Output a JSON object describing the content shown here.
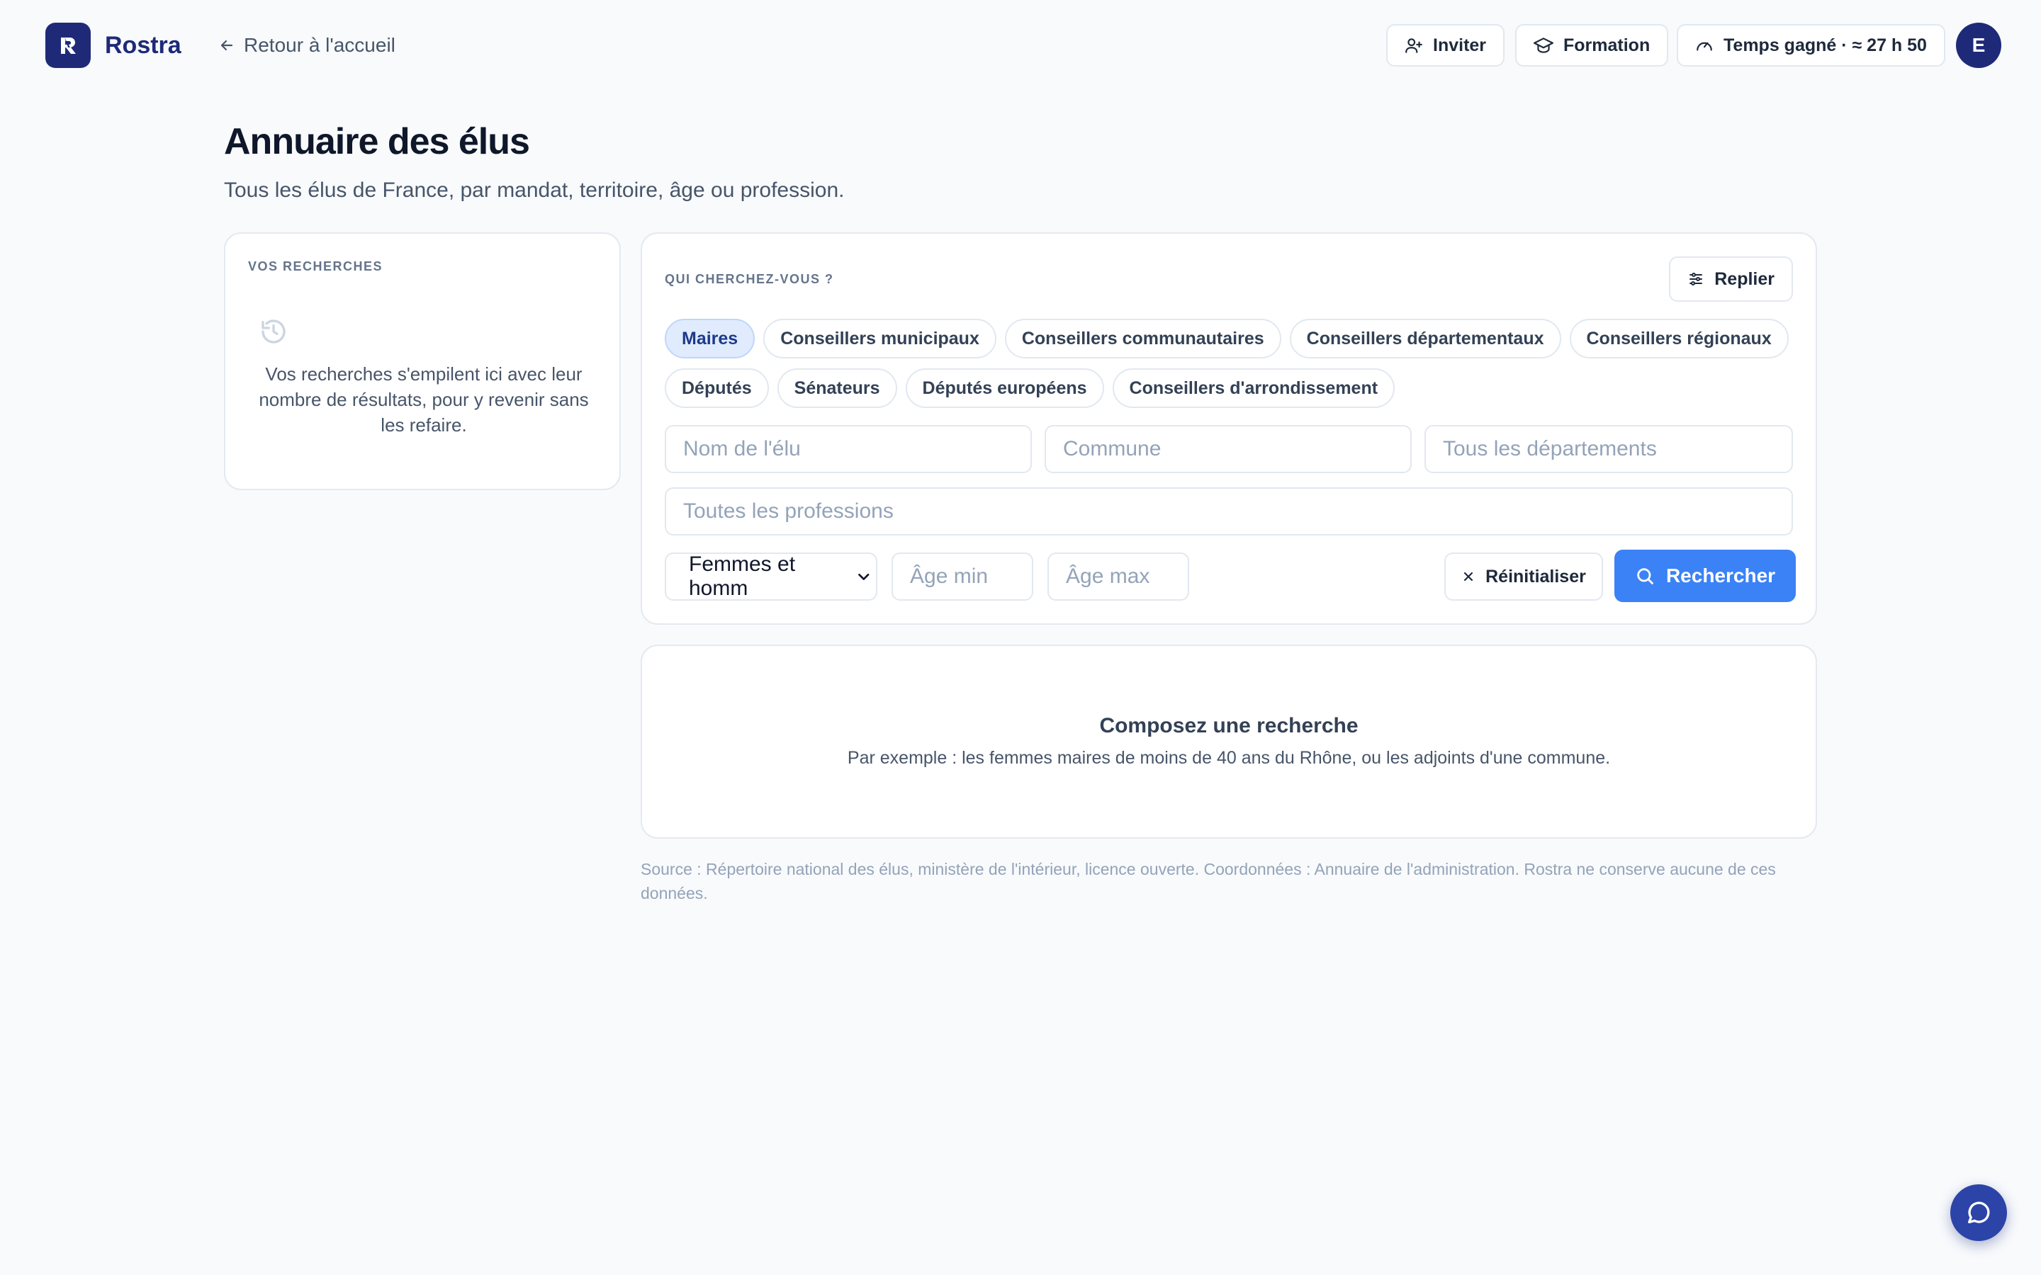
{
  "header": {
    "brand": "Rostra",
    "back_label": "Retour à l'accueil",
    "invite_label": "Inviter",
    "training_label": "Formation",
    "time_saved_label": "Temps gagné · ≈ 27 h 50",
    "avatar_initial": "E"
  },
  "page": {
    "title": "Annuaire des élus",
    "subtitle": "Tous les élus de France, par mandat, territoire, âge ou profession."
  },
  "history": {
    "label": "VOS RECHERCHES",
    "empty_text": "Vos recherches s'empilent ici avec leur nombre de résultats, pour y revenir sans les refaire."
  },
  "search": {
    "label": "QUI CHERCHEZ-VOUS ?",
    "fold_label": "Replier",
    "mandates": [
      {
        "label": "Maires",
        "active": true
      },
      {
        "label": "Conseillers municipaux",
        "active": false
      },
      {
        "label": "Conseillers communautaires",
        "active": false
      },
      {
        "label": "Conseillers départementaux",
        "active": false
      },
      {
        "label": "Conseillers régionaux",
        "active": false
      },
      {
        "label": "Députés",
        "active": false
      },
      {
        "label": "Sénateurs",
        "active": false
      },
      {
        "label": "Députés européens",
        "active": false
      },
      {
        "label": "Conseillers d'arrondissement",
        "active": false
      }
    ],
    "name_placeholder": "Nom de l'élu",
    "commune_placeholder": "Commune",
    "department_placeholder": "Tous les départements",
    "profession_placeholder": "Toutes les professions",
    "gender_value": "Femmes et homm",
    "age_min_placeholder": "Âge min",
    "age_max_placeholder": "Âge max",
    "reset_label": "Réinitialiser",
    "submit_label": "Rechercher"
  },
  "empty_state": {
    "title": "Composez une recherche",
    "text": "Par exemple : les femmes maires de moins de 40 ans du Rhône, ou les adjoints d'une commune."
  },
  "footer": {
    "source": "Source : Répertoire national des élus, ministère de l'intérieur, licence ouverte. Coordonnées : Annuaire de l'administration. Rostra ne conserve aucune de ces données."
  },
  "colors": {
    "brand": "#1e2a78",
    "accent": "#3b82f6",
    "chip_active_bg": "#e0ecfd",
    "background": "#f8fafc"
  },
  "icons": {
    "back": "arrow-left-icon",
    "invite": "user-plus-icon",
    "training": "graduation-cap-icon",
    "time_saved": "gauge-icon",
    "fold": "sliders-icon",
    "history": "history-icon",
    "reset": "close-icon",
    "search": "search-icon",
    "chat": "chat-bubble-icon"
  }
}
